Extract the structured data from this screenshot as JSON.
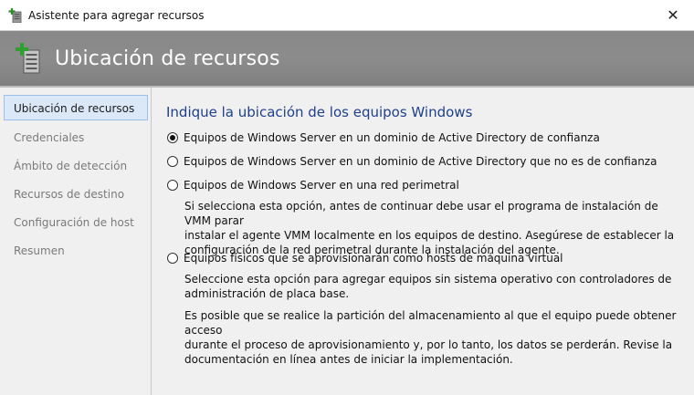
{
  "window": {
    "title": "Asistente para agregar recursos",
    "close_glyph": "✕"
  },
  "banner": {
    "title": "Ubicación de recursos"
  },
  "sidebar": {
    "items": [
      {
        "label": "Ubicación de recursos",
        "active": true
      },
      {
        "label": "Credenciales",
        "active": false
      },
      {
        "label": "Ámbito de detección",
        "active": false
      },
      {
        "label": "Recursos de destino",
        "active": false
      },
      {
        "label": "Configuración de host",
        "active": false
      },
      {
        "label": "Resumen",
        "active": false
      }
    ]
  },
  "main": {
    "heading": "Indique la ubicación de los equipos Windows",
    "options": [
      {
        "label": "Equipos de Windows Server en un dominio de Active Directory de confianza",
        "checked": true
      },
      {
        "label": "Equipos de Windows Server en un dominio de Active Directory que no es de confianza",
        "checked": false
      },
      {
        "label": "Equipos de Windows Server en una red perimetral",
        "checked": false,
        "description": [
          "Si selecciona esta opción, antes de continuar debe usar el programa de instalación de VMM parar",
          "instalar el agente VMM localmente en los equipos de destino. Asegúrese de establecer la",
          "configuración de la red perimetral durante la instalación del agente."
        ]
      },
      {
        "label": "Equipos físicos que se aprovisionarán como hosts de máquina virtual",
        "checked": false,
        "description": [
          "Seleccione esta opción para agregar equipos sin sistema operativo con controladores de",
          "administración de placa base."
        ],
        "note": [
          "Es posible que se realice la partición del almacenamiento al que el equipo puede obtener acceso",
          "durante el proceso de aprovisionamiento y, por lo tanto, los datos se perderán. Revise la",
          "documentación en línea antes de iniciar la implementación."
        ]
      }
    ]
  },
  "colors": {
    "banner": "#888888",
    "heading": "#1e3f8a",
    "nav_active_bg": "#dbe8f8",
    "nav_active_border": "#9cc0ec"
  },
  "icons": {
    "window": "server-add-icon",
    "banner": "server-add-icon",
    "close": "close-icon"
  }
}
